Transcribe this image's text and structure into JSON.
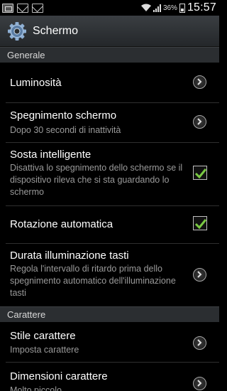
{
  "status_bar": {
    "battery_percent": "36%",
    "time": "15:57"
  },
  "header": {
    "title": "Schermo"
  },
  "sections": {
    "general": "Generale",
    "font": "Carattere"
  },
  "settings": {
    "brightness": {
      "title": "Luminosità"
    },
    "screen_timeout": {
      "title": "Spegnimento schermo",
      "subtitle": "Dopo 30 secondi di inattività"
    },
    "smart_stay": {
      "title": "Sosta intelligente",
      "subtitle": "Disattiva lo spegnimento dello schermo se il dispositivo rileva che si sta guardando lo schermo",
      "checked": true
    },
    "auto_rotate": {
      "title": "Rotazione automatica",
      "checked": true
    },
    "touch_key_light": {
      "title": "Durata illuminazione tasti",
      "subtitle": "Regola l'intervallo di ritardo prima dello spegnimento automatico dell'illuminazione tasti"
    },
    "font_style": {
      "title": "Stile carattere",
      "subtitle": "Imposta carattere"
    },
    "font_size": {
      "title": "Dimensioni carattere",
      "subtitle": "Molto piccolo"
    }
  },
  "colors": {
    "check_green": "#7ac943",
    "section_bg": "#2b2e31",
    "subtitle_gray": "#9a9a9a"
  }
}
